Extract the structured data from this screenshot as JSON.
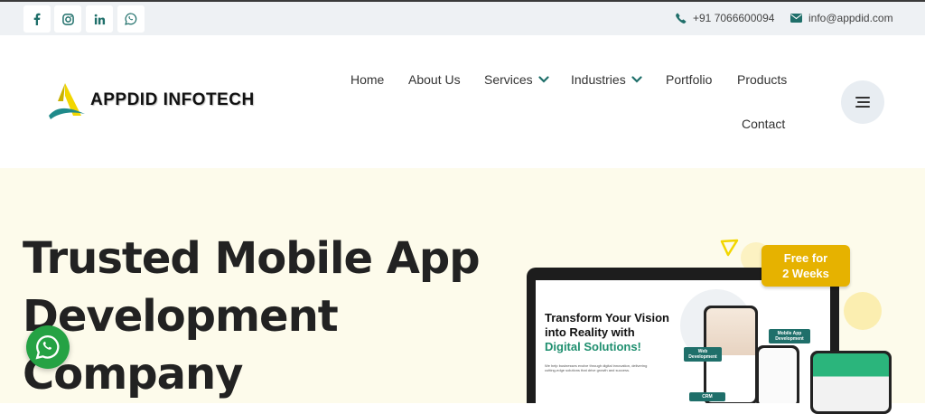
{
  "colors": {
    "accent": "#1f6f6a",
    "hero_bg": "#fdfbeb",
    "badge": "#e6b200",
    "whatsapp": "#25a244"
  },
  "topbar": {
    "social_icons": [
      "facebook-icon",
      "instagram-icon",
      "linkedin-icon",
      "whatsapp-icon"
    ],
    "phone": "+91 7066600094",
    "email": "info@appdid.com"
  },
  "brand": {
    "name": "APPDID INFOTECH"
  },
  "nav": {
    "home": "Home",
    "about": "About Us",
    "services": "Services",
    "industries": "Industries",
    "portfolio": "Portfolio",
    "products": "Products",
    "contact": "Contact"
  },
  "hero": {
    "title_line1": "Trusted Mobile App",
    "title_line2": "Development",
    "title_line3": "Company"
  },
  "mockup": {
    "headline_line1": "Transform Your Vision",
    "headline_line2": "into Reality with",
    "headline_accent": "Digital Solutions!",
    "subtext": "We help businesses evolve through digital innovation, delivering cutting-edge solutions that drive growth and success.",
    "tag_web": "Web Development",
    "tag_mobile": "Mobile App Development",
    "tag_crm": "CRM",
    "badge_line1": "Free for",
    "badge_line2": "2 Weeks"
  }
}
